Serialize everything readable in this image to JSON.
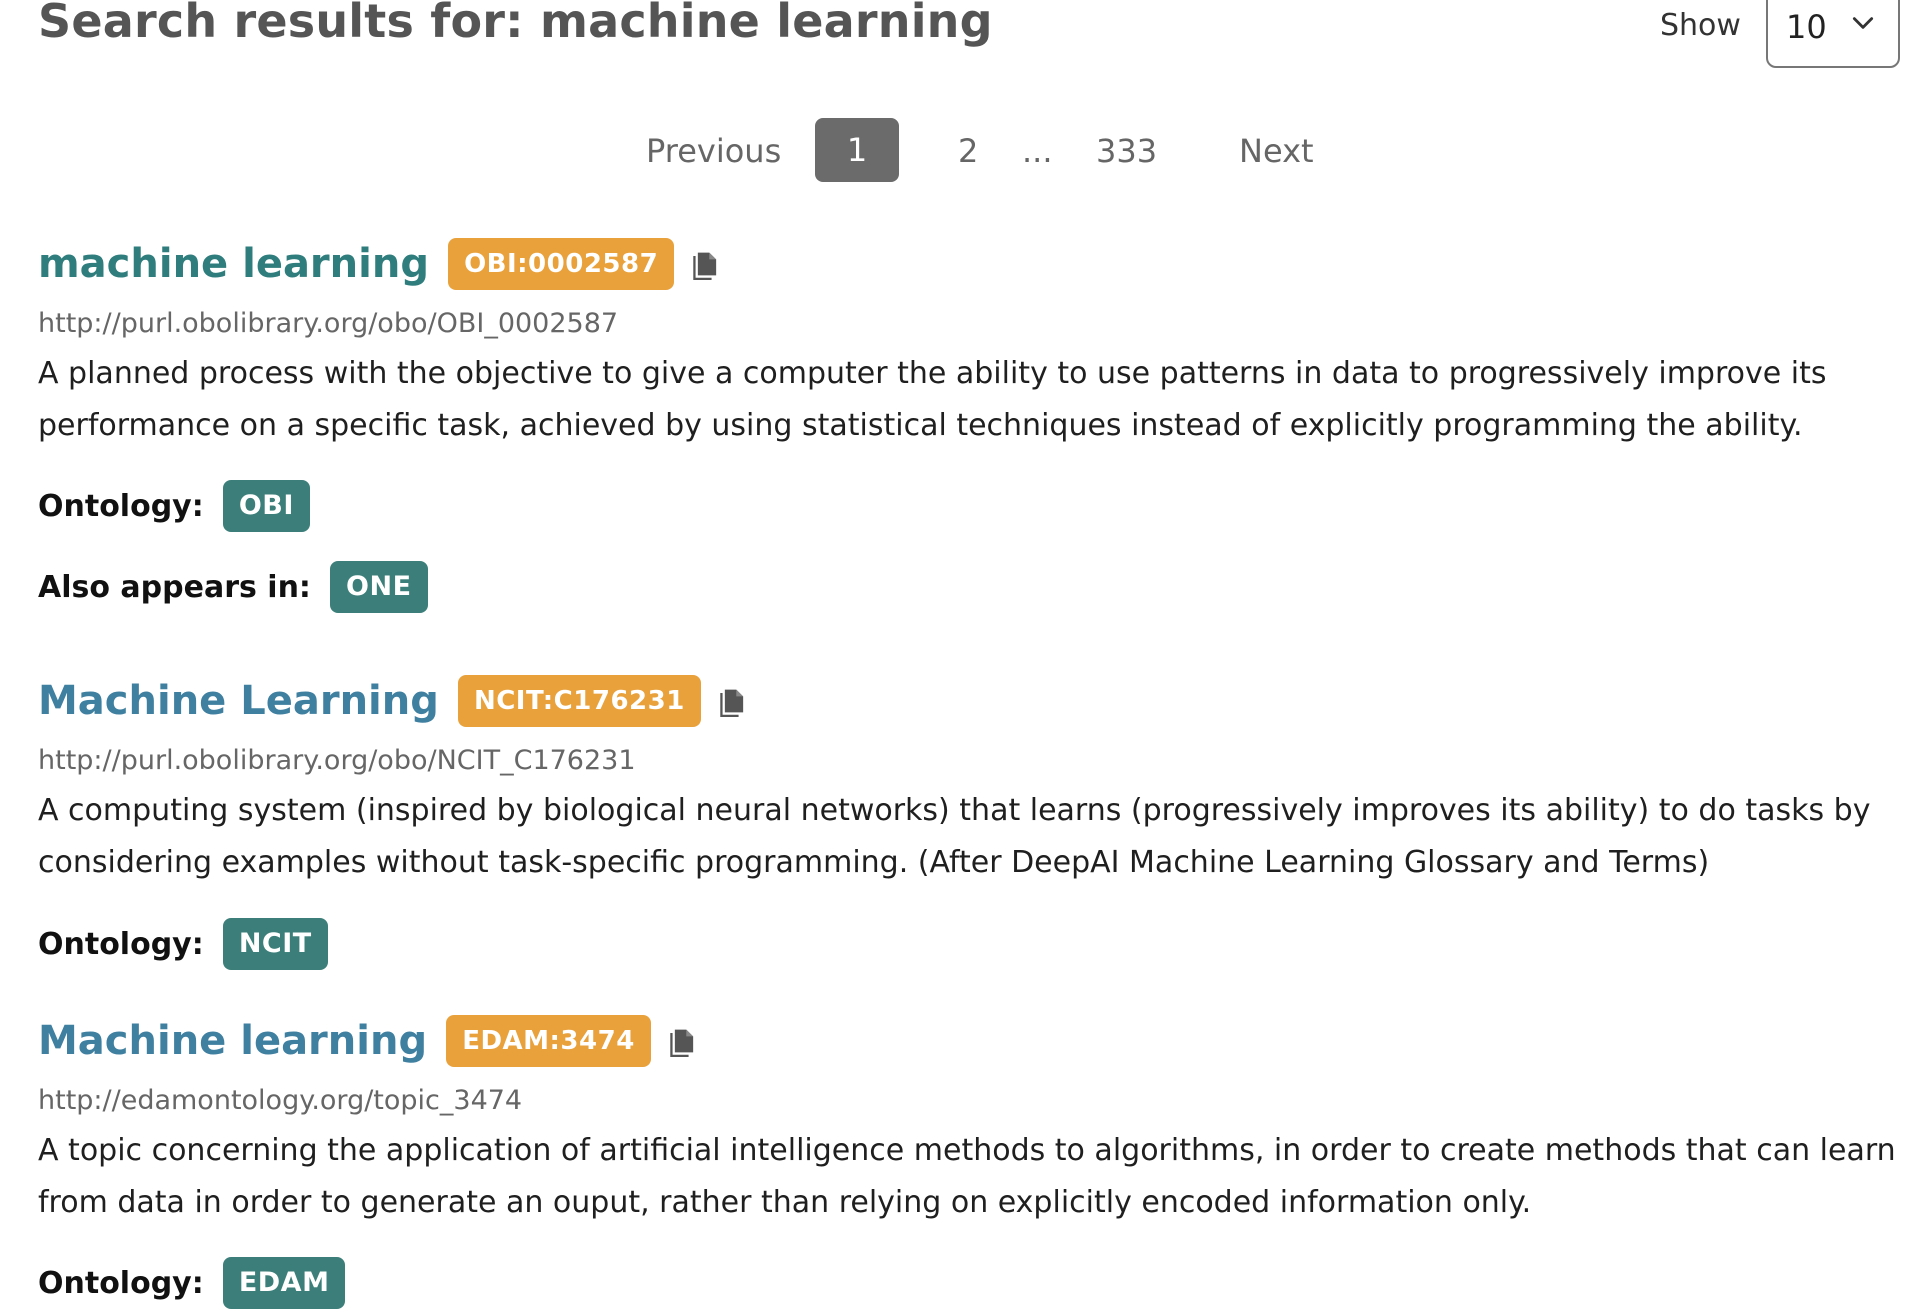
{
  "header": {
    "title": "Search results for: machine learning",
    "show_label": "Show",
    "page_size": "10"
  },
  "pagination": {
    "previous": "Previous",
    "current": "1",
    "page2": "2",
    "ellipsis": "...",
    "last": "333",
    "next": "Next"
  },
  "results": [
    {
      "title": "machine learning",
      "id": "OBI:0002587",
      "iri": "http://purl.obolibrary.org/obo/OBI_0002587",
      "description": "A planned process with the objective to give a computer the ability to use patterns in data to progressively improve its performance on a specific task, achieved by using statistical techniques instead of explicitly programming the ability.",
      "ontology_label": "Ontology:",
      "ontology": "OBI",
      "also_label": "Also appears in:",
      "also": "ONE"
    },
    {
      "title": "Machine Learning",
      "id": "NCIT:C176231",
      "iri": "http://purl.obolibrary.org/obo/NCIT_C176231",
      "description": "A computing system (inspired by biological neural networks) that learns (progressively improves its ability) to do tasks by considering examples without task-specific programming. (After DeepAI Machine Learning Glossary and Terms)",
      "ontology_label": "Ontology:",
      "ontology": "NCIT"
    },
    {
      "title": "Machine learning",
      "id": "EDAM:3474",
      "iri": "http://edamontology.org/topic_3474",
      "description": "A topic concerning the application of artificial intelligence methods to algorithms, in order to create methods that can learn from data in order to generate an ouput, rather than relying on explicitly encoded information only.",
      "ontology_label": "Ontology:",
      "ontology": "EDAM"
    }
  ],
  "colors": {
    "title_teal": "#2f7d7d",
    "title_blue": "#3f7fa0",
    "id_badge": "#e9a13b",
    "ontology_badge": "#3c7f7a",
    "pager_active": "#6b6b6b"
  },
  "icons": {
    "copy": "copy-icon",
    "dropdown": "chevron-down-icon"
  }
}
